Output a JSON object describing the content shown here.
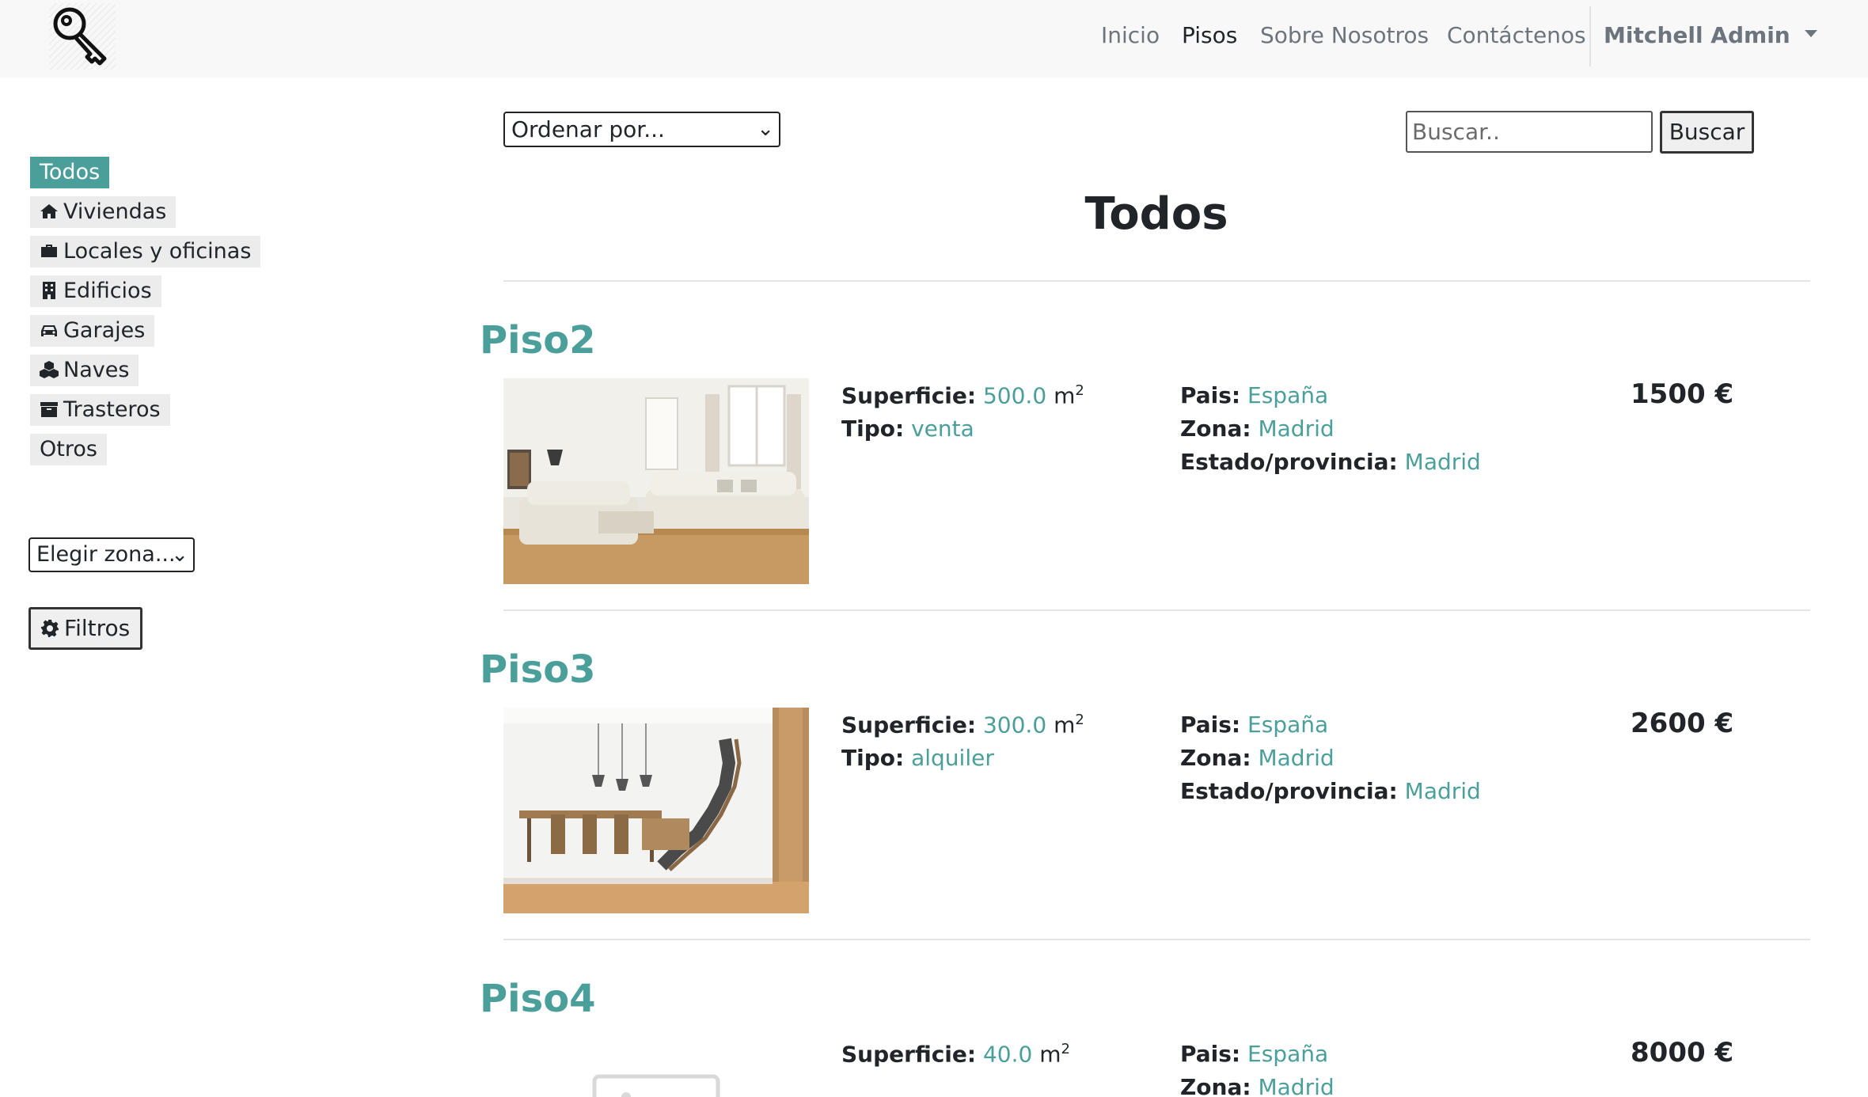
{
  "nav": {
    "logo_icon": "key-icon",
    "links": [
      "Inicio",
      "Pisos",
      "Sobre Nosotros",
      "Contáctenos"
    ],
    "active": "Pisos",
    "user": "Mitchell Admin"
  },
  "sidebar": {
    "categories": [
      {
        "label": "Todos",
        "icon": "",
        "active": true
      },
      {
        "label": "Viviendas",
        "icon": "home-icon"
      },
      {
        "label": "Locales y oficinas",
        "icon": "briefcase-icon"
      },
      {
        "label": "Edificios",
        "icon": "building-icon"
      },
      {
        "label": "Garajes",
        "icon": "car-icon"
      },
      {
        "label": "Naves",
        "icon": "cubes-icon"
      },
      {
        "label": "Trasteros",
        "icon": "archive-icon"
      },
      {
        "label": "Otros",
        "icon": ""
      }
    ],
    "zone_select": "Elegir zona...",
    "filter_button": "Filtros"
  },
  "toolbar": {
    "sort_select": "Ordenar por...",
    "search_placeholder": "Buscar..",
    "search_button": "Buscar"
  },
  "main": {
    "title": "Todos",
    "labels": {
      "superficie": "Superficie:",
      "tipo": "Tipo:",
      "pais": "Pais:",
      "zona": "Zona:",
      "estado": "Estado/provincia:",
      "unit": "m",
      "unit_exp": "2"
    },
    "listings": [
      {
        "name": "Piso2",
        "superficie": "500.0",
        "tipo": "venta",
        "pais": "España",
        "zona": "Madrid",
        "estado": "Madrid",
        "price": "1500 €"
      },
      {
        "name": "Piso3",
        "superficie": "300.0",
        "tipo": "alquiler",
        "pais": "España",
        "zona": "Madrid",
        "estado": "Madrid",
        "price": "2600 €"
      },
      {
        "name": "Piso4",
        "superficie": "40.0",
        "tipo": "",
        "pais": "España",
        "zona": "Madrid",
        "estado": "",
        "price": "8000 €"
      }
    ]
  },
  "colors": {
    "accent": "#4a9f9a",
    "navbar": "#f8f8f8"
  }
}
